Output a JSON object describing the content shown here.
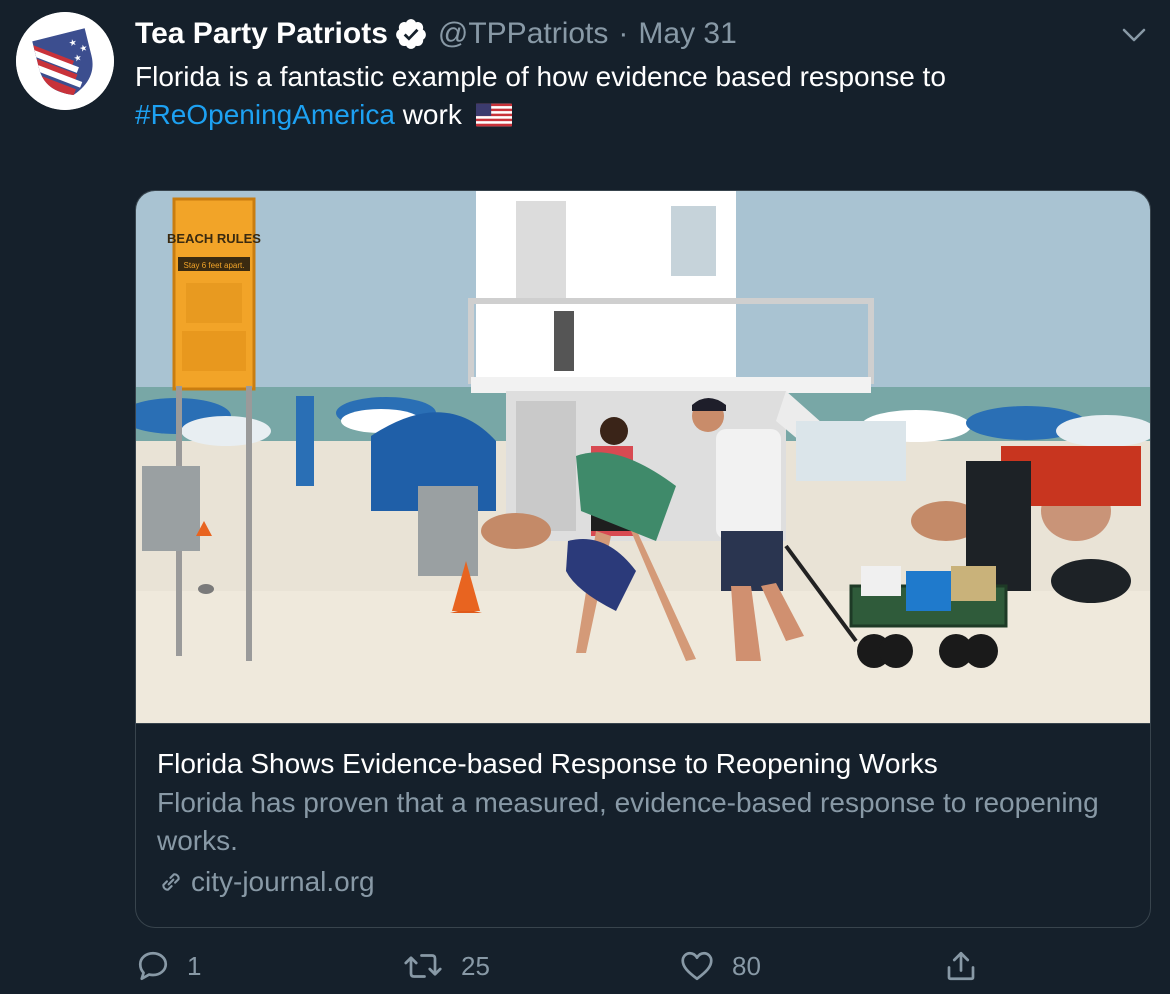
{
  "tweet": {
    "display_name": "Tea Party Patriots",
    "handle": "@TPPatriots",
    "separator": "·",
    "date": "May 31",
    "text_before": "Florida is a fantastic example of how evidence based response to ",
    "hashtag": "#ReOpeningAmerica",
    "text_after": " work",
    "emoji": "flag-us-icon"
  },
  "card": {
    "image_sign": {
      "title": "BEACH RULES",
      "subtitle": "Stay 6 feet apart."
    },
    "title": "Florida Shows Evidence-based Response to Reopening Works",
    "description": "Florida has proven that a measured, evidence-based response to reopening works.",
    "domain": "city-journal.org"
  },
  "actions": {
    "reply_count": "1",
    "retweet_count": "25",
    "like_count": "80"
  },
  "colors": {
    "background": "#15202b",
    "link": "#1da1f2",
    "muted": "#8899a6",
    "border": "#38444d"
  }
}
